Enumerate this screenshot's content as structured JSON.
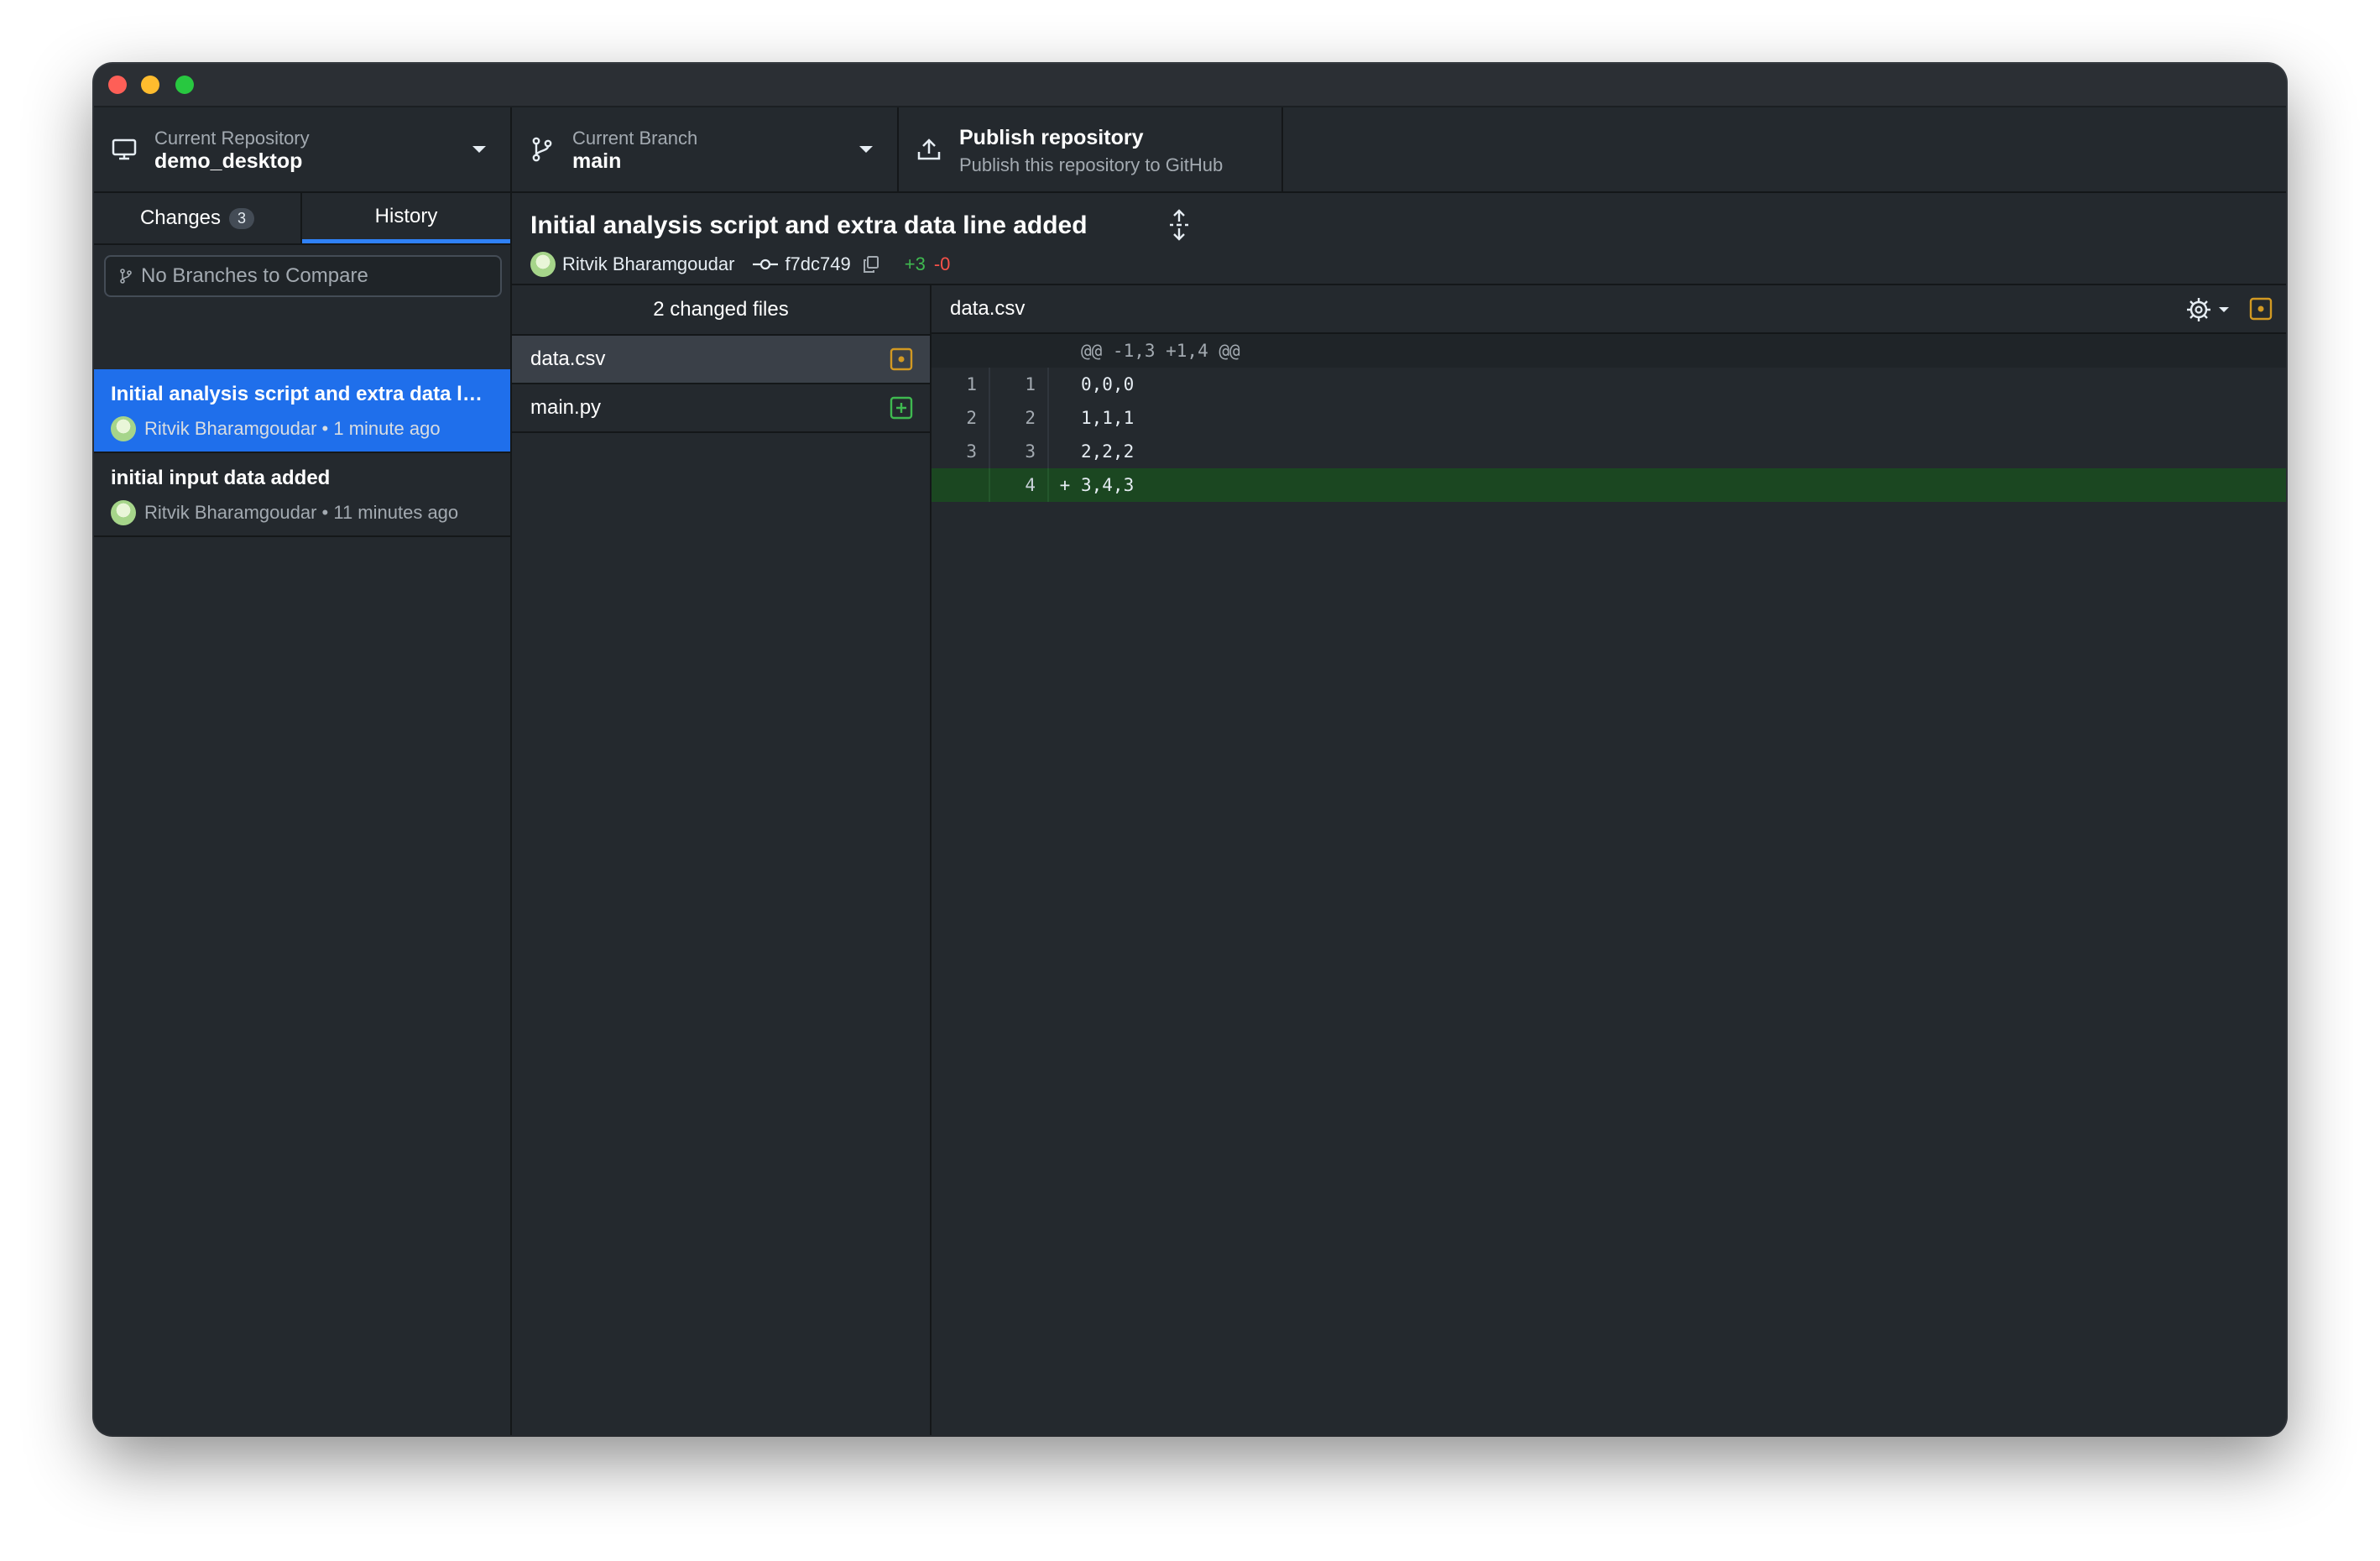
{
  "toolbar": {
    "repo_label": "Current Repository",
    "repo_value": "demo_desktop",
    "branch_label": "Current Branch",
    "branch_value": "main",
    "publish_title": "Publish repository",
    "publish_subtitle": "Publish this repository to GitHub"
  },
  "sidebar": {
    "tabs": [
      {
        "label": "Changes",
        "badge": "3"
      },
      {
        "label": "History"
      }
    ],
    "compare_placeholder": "No Branches to Compare",
    "commits": [
      {
        "title": "Initial analysis script and extra data line added",
        "author": "Ritvik Bharamgoudar",
        "time": "1 minute ago",
        "meta": "Ritvik Bharamgoudar • 1 minute ago"
      },
      {
        "title": "initial input data added",
        "author": "Ritvik Bharamgoudar",
        "time": "11 minutes ago",
        "meta": "Ritvik Bharamgoudar • 11 minutes ago"
      }
    ]
  },
  "commit": {
    "title": "Initial analysis script and extra data line added",
    "author": "Ritvik Bharamgoudar",
    "sha": "f7dc749",
    "additions": "+3",
    "deletions": "-0"
  },
  "files": {
    "header": "2 changed files",
    "items": [
      {
        "name": "data.csv",
        "status": "modified"
      },
      {
        "name": "main.py",
        "status": "added"
      }
    ]
  },
  "diff": {
    "filename": "data.csv",
    "hunk": "@@ -1,3 +1,4 @@",
    "lines": [
      {
        "old": "1",
        "new": "1",
        "marker": "",
        "text": "0,0,0"
      },
      {
        "old": "2",
        "new": "2",
        "marker": "",
        "text": "1,1,1"
      },
      {
        "old": "3",
        "new": "3",
        "marker": "",
        "text": "2,2,2"
      },
      {
        "old": "",
        "new": "4",
        "marker": "+",
        "text": "3,4,3"
      }
    ]
  },
  "colors": {
    "accent": "#1f6feb",
    "modified": "#d29922",
    "added": "#3fb950",
    "deleted": "#f85149"
  }
}
